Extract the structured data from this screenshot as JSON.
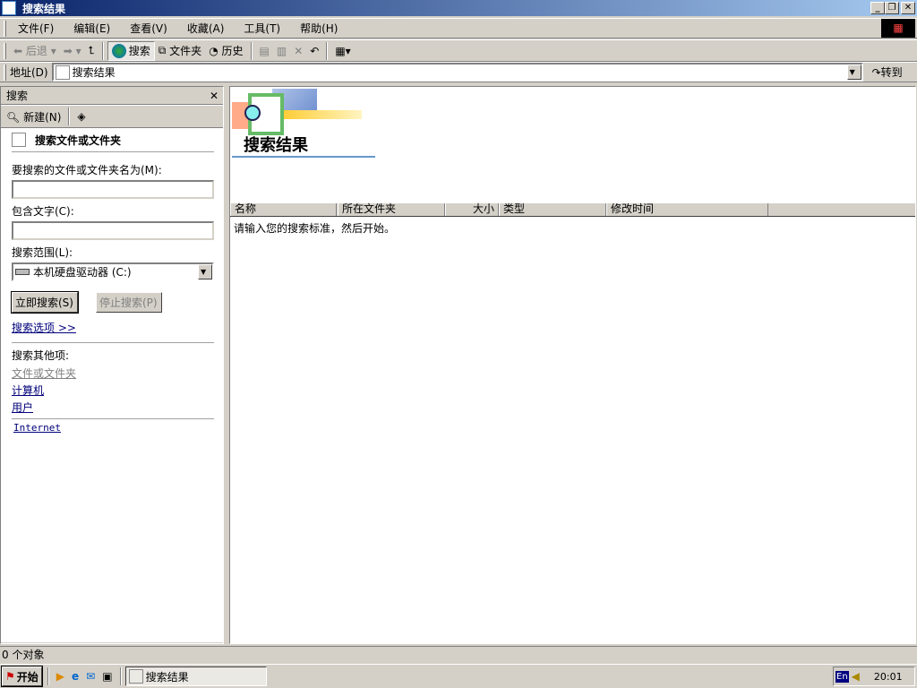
{
  "window": {
    "title": "搜索结果"
  },
  "menu": [
    "文件(F)",
    "编辑(E)",
    "查看(V)",
    "收藏(A)",
    "工具(T)",
    "帮助(H)"
  ],
  "toolbar": {
    "back": "后退",
    "search": "搜索",
    "folders": "文件夹",
    "history": "历史"
  },
  "address": {
    "label": "地址(D)",
    "value": "搜索结果",
    "go": "转到"
  },
  "search_pane": {
    "title": "搜索",
    "new": "新建(N)",
    "heading": "搜索文件或文件夹",
    "name_label": "要搜索的文件或文件夹名为(M):",
    "name_value": "",
    "text_label": "包含文字(C):",
    "text_value": "",
    "scope_label": "搜索范围(L):",
    "scope_value": "本机硬盘驱动器 (C:)",
    "search_now": "立即搜索(S)",
    "stop": "停止搜索(P)",
    "options": "搜索选项 >>",
    "other_label": "搜索其他项:",
    "other": [
      "文件或文件夹",
      "计算机",
      "用户"
    ],
    "internet": "Internet"
  },
  "results": {
    "title": "搜索结果",
    "columns": [
      "名称",
      "所在文件夹",
      "大小",
      "类型",
      "修改时间"
    ],
    "message": "请输入您的搜索标准，然后开始。"
  },
  "status": {
    "text": "0 个对象"
  },
  "taskbar": {
    "start": "开始",
    "task": "搜索结果",
    "lang": "En",
    "time": "20:01"
  }
}
